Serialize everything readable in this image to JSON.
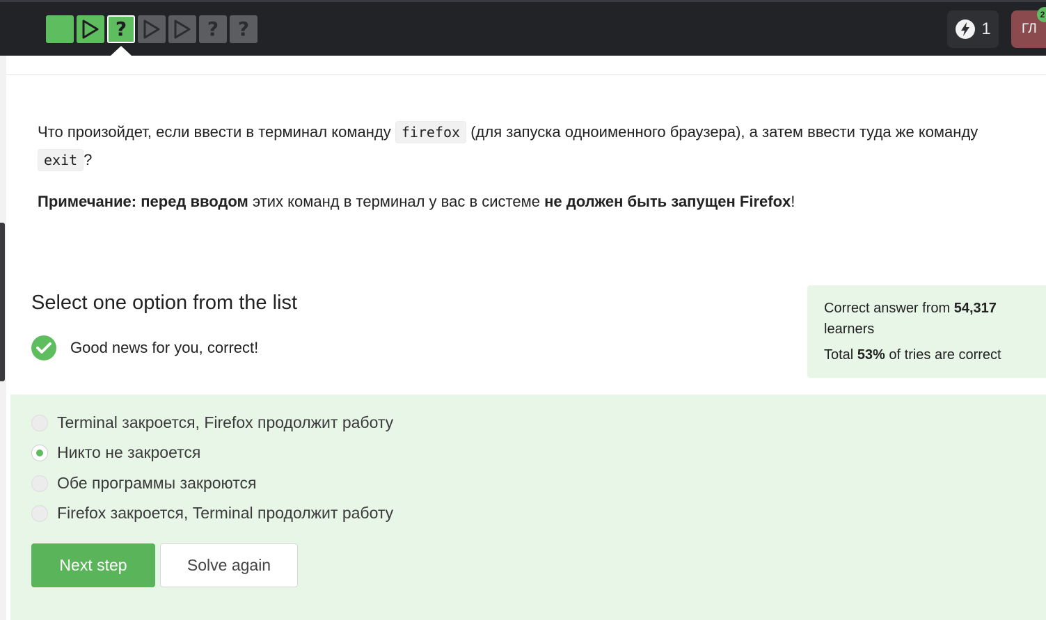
{
  "progress": {
    "steps": [
      {
        "name": "step-1",
        "status": "done",
        "kind": "text"
      },
      {
        "name": "step-2",
        "status": "done",
        "kind": "video"
      },
      {
        "name": "step-3",
        "status": "current",
        "kind": "quiz",
        "symbol": "?"
      },
      {
        "name": "step-4",
        "status": "todo",
        "kind": "video"
      },
      {
        "name": "step-5",
        "status": "todo",
        "kind": "video"
      },
      {
        "name": "step-6",
        "status": "todo",
        "kind": "quiz",
        "symbol": "?"
      },
      {
        "name": "step-7",
        "status": "todo",
        "kind": "quiz",
        "symbol": "?"
      }
    ]
  },
  "header": {
    "energy_icon": "lightning-icon",
    "energy_count": "1",
    "avatar_initials": "ГЛ",
    "avatar_badge": "2"
  },
  "question": {
    "part1": "Что произойдет, если ввести в терминал команду ",
    "code1": "firefox",
    "part2": " (для запуска одноименного браузера), а затем ввести туда же команду ",
    "code2": "exit",
    "part3": "?"
  },
  "note": {
    "bold1": "Примечание: перед вводом",
    "text1": " этих команд в терминал у вас в системе ",
    "bold2": "не должен быть запущен Firefox",
    "text2": "!"
  },
  "quiz": {
    "title": "Select one option from the list",
    "feedback": "Good news for you, correct!",
    "options": [
      {
        "label": "Terminal закроется, Firefox продолжит работу",
        "selected": false
      },
      {
        "label": "Никто не закроется",
        "selected": true
      },
      {
        "label": "Обе программы закроются",
        "selected": false
      },
      {
        "label": "Firefox закроется, Terminal продолжит работу",
        "selected": false
      }
    ],
    "next_button": "Next step",
    "solve_again_button": "Solve again"
  },
  "stats": {
    "line1_prefix": "Correct answer from ",
    "learners_count": "54,317",
    "line1_suffix": "learners",
    "line2_prefix": "Total ",
    "percent": "53%",
    "line2_suffix": " of tries are correct"
  },
  "colors": {
    "accent_green": "#5ebd5e",
    "panel_green": "#e8f6e8",
    "topbar": "#222326",
    "avatar": "#8a4a4e"
  }
}
